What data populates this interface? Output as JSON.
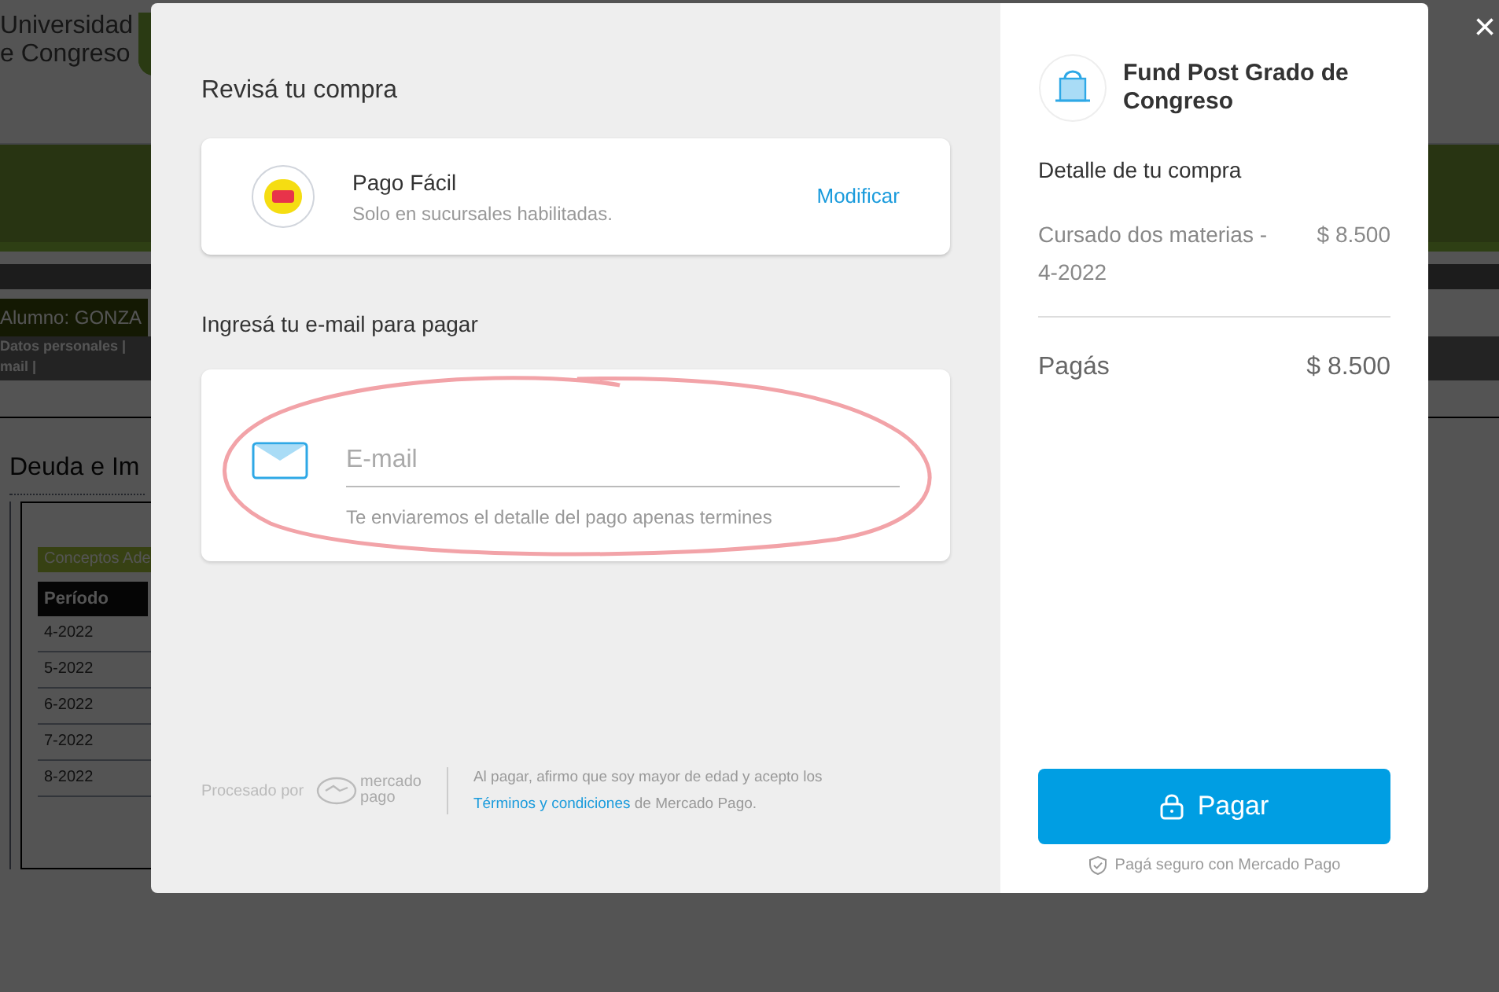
{
  "background_page": {
    "logo": {
      "line_1": "Universidad",
      "line_2": "e Congreso"
    },
    "student_label": "Alumno: GONZA",
    "nav_links": [
      "Datos personales |",
      "mail |"
    ],
    "section_title": "Deuda e Im",
    "table_caption": "Conceptos Ade",
    "table": {
      "columns": [
        "Período"
      ],
      "rows": [
        "4-2022",
        "5-2022",
        "6-2022",
        "7-2022",
        "8-2022"
      ]
    }
  },
  "close_button": "×",
  "checkout": {
    "title": "Revisá tu compra",
    "payment_method": {
      "name": "Pago Fácil",
      "note": "Solo en sucursales habilitadas.",
      "action": "Modificar"
    },
    "email_section": {
      "title": "Ingresá tu e-mail para pagar",
      "field": {
        "placeholder": "E-mail",
        "hint": "Te enviaremos el detalle del pago apenas termines"
      }
    },
    "footer": {
      "processed_by": "Procesado por",
      "brand_line_1": "mercado",
      "brand_line_2": "pago",
      "legal": "Al pagar, afirmo que soy mayor de edad y acepto los",
      "terms_link": "Términos y condiciones",
      "legal_end": "de Mercado Pago."
    }
  },
  "summary": {
    "merchant": "Fund Post Grado de Congreso",
    "detail_title": "Detalle de tu compra",
    "items": [
      {
        "name": "Cursado dos materias - 4-2022",
        "amount": "$ 8.500"
      }
    ],
    "total_label": "Pagás",
    "total_amount": "$ 8.500",
    "pay_button": "Pagar",
    "security_note": "Pagá seguro con Mercado Pago"
  }
}
